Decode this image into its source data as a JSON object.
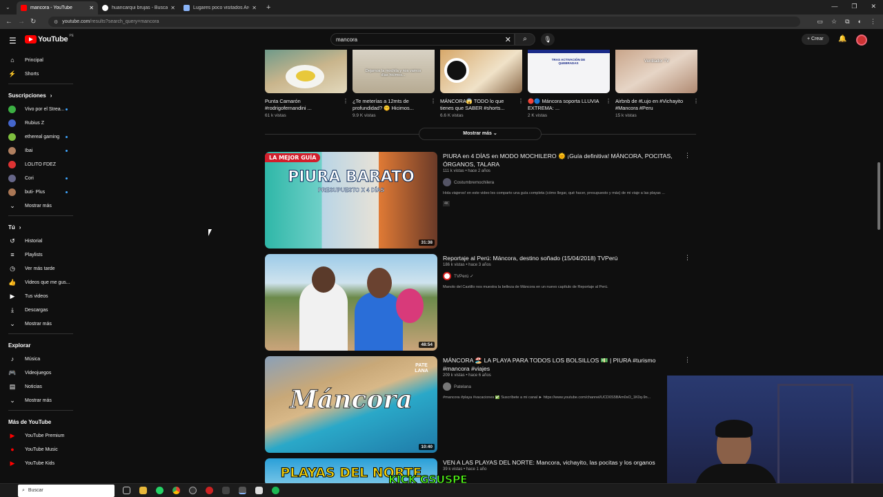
{
  "browser": {
    "tabs": [
      {
        "title": "mancora - YouTube",
        "active": true
      },
      {
        "title": "huancarqui brujas - Buscar con",
        "active": false
      },
      {
        "title": "Lugares poco visitados Arequip",
        "active": false
      }
    ],
    "url_host": "youtube.com",
    "url_path": "/results?search_query=mancora"
  },
  "header": {
    "logo": "YouTube",
    "region": "PE",
    "search_value": "mancora",
    "create_label": "Crear"
  },
  "sidebar": {
    "main": [
      {
        "label": "Principal",
        "icon": "home-icon"
      },
      {
        "label": "Shorts",
        "icon": "shorts-icon"
      }
    ],
    "subs_title": "Suscripciones",
    "subs": [
      {
        "label": "Vivo por el Strea...",
        "color": "#3cb043",
        "dot": true
      },
      {
        "label": "Rubius Z",
        "color": "#4466cc",
        "dot": false
      },
      {
        "label": "ethereal gaming",
        "color": "#7fbf3f",
        "dot": true
      },
      {
        "label": "Ibai",
        "color": "#b08060",
        "dot": true
      },
      {
        "label": "LOLITO FDEZ",
        "color": "#d33",
        "dot": false
      },
      {
        "label": "Cori",
        "color": "#668",
        "dot": true
      },
      {
        "label": "buti- Plus",
        "color": "#aa7755",
        "dot": true
      }
    ],
    "show_more": "Mostrar más",
    "you_title": "Tú",
    "you": [
      {
        "label": "Historial",
        "icon": "history-icon"
      },
      {
        "label": "Playlists",
        "icon": "playlist-icon"
      },
      {
        "label": "Ver más tarde",
        "icon": "clock-icon"
      },
      {
        "label": "Videos que me gus...",
        "icon": "thumbs-up-icon"
      },
      {
        "label": "Tus videos",
        "icon": "video-icon"
      },
      {
        "label": "Descargas",
        "icon": "download-icon"
      },
      {
        "label": "Mostrar más",
        "icon": "chevron-down-icon"
      }
    ],
    "explore_title": "Explorar",
    "explore": [
      {
        "label": "Música",
        "icon": "music-icon"
      },
      {
        "label": "Videojuegos",
        "icon": "gamepad-icon"
      },
      {
        "label": "Noticias",
        "icon": "news-icon"
      },
      {
        "label": "Mostrar más",
        "icon": "chevron-down-icon"
      }
    ],
    "more_title": "Más de YouTube",
    "more": [
      {
        "label": "YouTube Premium"
      },
      {
        "label": "YouTube Music"
      },
      {
        "label": "YouTube Kids"
      }
    ]
  },
  "shorts": [
    {
      "title": "Punta Camarón #rodrigofernandini ...",
      "views": "61 k vistas"
    },
    {
      "title": "¿Te meterías a 12mts de profundidad? 🤫 Hicimos...",
      "views": "9.9 K vistas",
      "overlay": "Dejamos la mochila y nos vamos días hicimos..."
    },
    {
      "title": "MÁNCORA😱 TODO lo que tienes que SABER #shorts...",
      "views": "6.6 K vistas"
    },
    {
      "title": "🔴🔵 Máncora soporta LLUVIA EXTREMA: ...",
      "views": "2 K vistas",
      "overlay": "TRAS ACTIVACIÓN DE QUEBRADAS"
    },
    {
      "title": "Airbnb de #Lujo en #Vichayito #Mancora #Peru",
      "views": "15 k vistas",
      "overlay": "Ventilador TV"
    }
  ],
  "show_more_btn": "Mostrar más",
  "videos": [
    {
      "title": "PIURA en 4 DÍAS en MODO MOCHILERO 🌞 ¡Guía definitiva! MÁNCORA, POCITAS, ÓRGANOS, TALARA",
      "meta": "111 k vistas • hace 2 años",
      "channel": "Costumbremochilera",
      "desc": "Hola viajeros! en este video les comparto una guía completa (cómo llegar, qué hacer, presupuesto y más) de mi viaje a las playas ...",
      "badge": "4K",
      "duration": "31:38",
      "thumb_tag": "LA MEJOR GUÍA",
      "thumb_title": "PIURA BARATO",
      "thumb_sub": "PRESUPUESTO X 4 DÍAS"
    },
    {
      "title": "Reportaje al Perú: Máncora, destino soñado (15/04/2018) TVPerú",
      "meta": "186 k vistas • hace 3 años",
      "channel": "TVPerú ✓",
      "desc": "Manolo del Castillo nos muestra la belleza de Máncora en un nuevo capítulo de Reportaje al Perú.",
      "duration": "48:54"
    },
    {
      "title": "MÁNCORA 🏖️ LA PLAYA PARA TODOS LOS BOLSILLOS 💵 | PIURA #turismo #mancora #viajes",
      "meta": "209 k vistas • hace 6 años",
      "channel": "Patelana",
      "desc": "#mancora #playa #vacaciones ✅ Suscríbete a mi canal ► https://www.youtube.com/channel/UCD0S5BAm0sO_1K0q-9n...",
      "duration": "10:40",
      "thumb_title": "Máncora",
      "thumb_tag": "PATE LANA"
    },
    {
      "title": "VEN A LAS PLAYAS DEL NORTE: Mancora, vichayito, las pocitas y los organos",
      "meta": "39 k vistas • hace 1 año",
      "thumb_title": "PLAYAS DEL NORTE"
    }
  ],
  "overlay_text": "KICK GSUSPE",
  "taskbar": {
    "search": "Buscar"
  }
}
